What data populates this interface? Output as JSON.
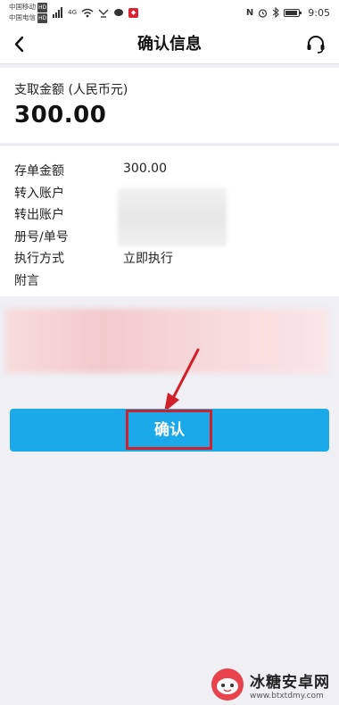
{
  "status_bar": {
    "carrier_1": "中国移动",
    "carrier_2": "中国电信",
    "hd": "HD",
    "network": "4G",
    "time": "9:05",
    "icons": [
      "signal-icon",
      "wifi-icon",
      "notification-icon",
      "nfc-icon",
      "alarm-icon",
      "bluetooth-icon",
      "battery-icon"
    ],
    "battery_level": 0.9
  },
  "nav": {
    "title": "确认信息",
    "back_icon": "chevron-left-icon",
    "service_icon": "headset-icon"
  },
  "amount": {
    "label": "支取金额 (人民币元)",
    "value": "300.00"
  },
  "details": [
    {
      "key": "存单金额",
      "value": "300.00"
    },
    {
      "key": "转入账户",
      "value": ""
    },
    {
      "key": "转出账户",
      "value": ""
    },
    {
      "key": "册号/单号",
      "value": ""
    },
    {
      "key": "执行方式",
      "value": "立即执行"
    },
    {
      "key": "附言",
      "value": ""
    }
  ],
  "confirm_button": {
    "label": "确认"
  },
  "colors": {
    "accent": "#1ba9ea",
    "highlight": "#d0202a",
    "background": "#efeff4"
  },
  "watermark": {
    "name": "冰糖安卓网",
    "url": "www.btxtdmy.com"
  }
}
